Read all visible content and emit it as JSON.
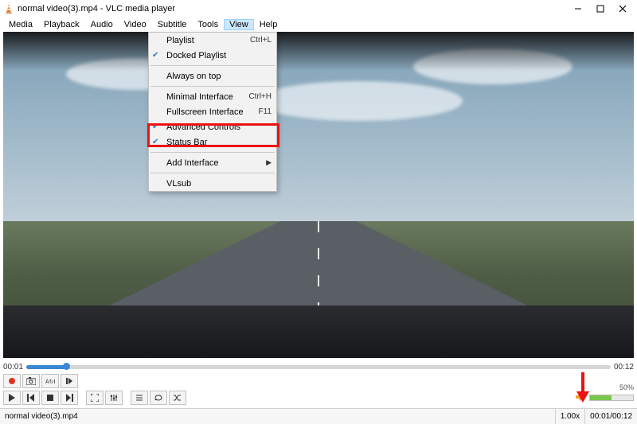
{
  "window": {
    "title": "normal video(3).mp4 - VLC media player"
  },
  "menubar": {
    "items": [
      "Media",
      "Playback",
      "Audio",
      "Video",
      "Subtitle",
      "Tools",
      "View",
      "Help"
    ],
    "active": "View"
  },
  "view_menu": {
    "playlist": {
      "label": "Playlist",
      "shortcut": "Ctrl+L"
    },
    "docked_playlist": {
      "label": "Docked Playlist",
      "checked": true
    },
    "always_on_top": {
      "label": "Always on top"
    },
    "minimal_interface": {
      "label": "Minimal Interface",
      "shortcut": "Ctrl+H"
    },
    "fullscreen_interface": {
      "label": "Fullscreen Interface",
      "shortcut": "F11"
    },
    "advanced_controls": {
      "label": "Advanced Controls",
      "checked": true
    },
    "status_bar": {
      "label": "Status Bar",
      "checked": true
    },
    "add_interface": {
      "label": "Add Interface"
    },
    "vlsub": {
      "label": "VLsub"
    }
  },
  "seek": {
    "elapsed": "00:01",
    "total": "00:12"
  },
  "volume": {
    "percent_label": "50%"
  },
  "status": {
    "filename": "normal video(3).mp4",
    "speed": "1.00x",
    "time": "00:01/00:12"
  }
}
